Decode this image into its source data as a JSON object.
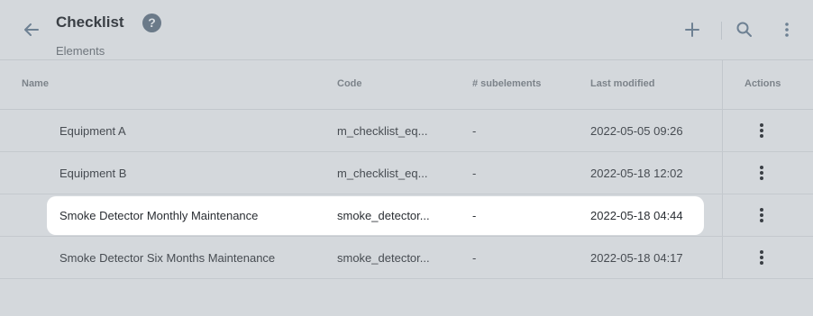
{
  "header": {
    "title": "Checklist",
    "help_icon_glyph": "?",
    "subtitle": "Elements"
  },
  "table": {
    "columns": {
      "name": "Name",
      "code": "Code",
      "subelements": "# subelements",
      "last_modified": "Last modified",
      "actions": "Actions"
    },
    "rows": [
      {
        "name": "Equipment A",
        "code": "m_checklist_eq...",
        "subelements": "-",
        "last_modified": "2022-05-05 09:26"
      },
      {
        "name": "Equipment B",
        "code": "m_checklist_eq...",
        "subelements": "-",
        "last_modified": "2022-05-18 12:02"
      },
      {
        "name": "Smoke Detector Monthly Maintenance",
        "code": "smoke_detector...",
        "subelements": "-",
        "last_modified": "2022-05-18 04:44"
      },
      {
        "name": "Smoke Detector Six Months Maintenance",
        "code": "smoke_detector...",
        "subelements": "-",
        "last_modified": "2022-05-18 04:17"
      }
    ]
  },
  "icons": [
    "back-arrow-icon",
    "help-icon",
    "plus-icon",
    "search-icon",
    "more-vertical-icon"
  ],
  "colors": {
    "background": "#d4d8dc",
    "highlight_row": "#ffffff",
    "text": "#3d4146",
    "help_icon": "#6b7a89"
  }
}
